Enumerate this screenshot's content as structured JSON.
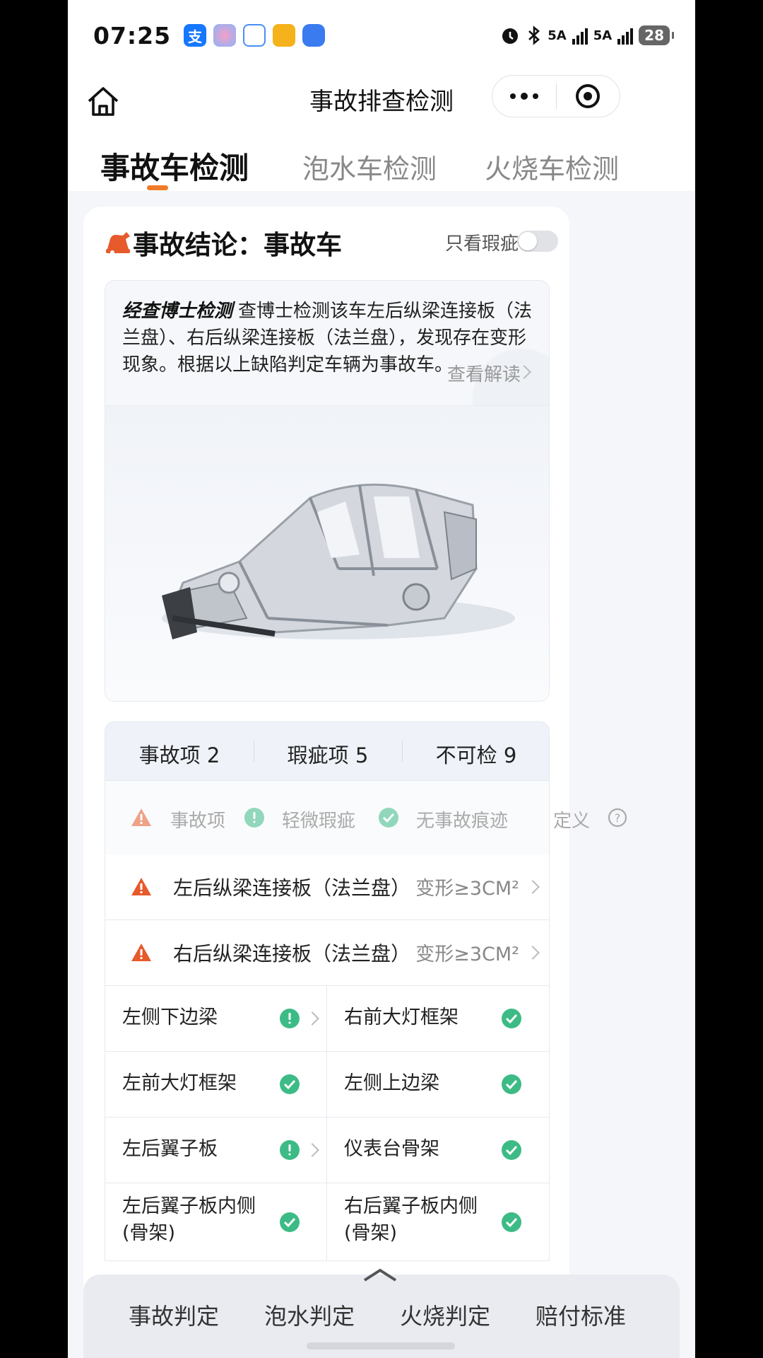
{
  "status_bar": {
    "time": "07:25",
    "network1": "5A",
    "network2": "5A",
    "battery": "28"
  },
  "nav": {
    "title": "事故排查检测"
  },
  "tabs": [
    {
      "label": "事故车检测",
      "active": true
    },
    {
      "label": "泡水车检测",
      "active": false
    },
    {
      "label": "火烧车检测",
      "active": false
    }
  ],
  "conclusion": {
    "title": "事故结论：事故车",
    "toggle_label": "只看瑕疵",
    "toggle_on": false
  },
  "diagnosis": {
    "brand": "经查博士检测",
    "text": "查博士检测该车左后纵梁连接板（法兰盘）、右后纵梁连接板（法兰盘），发现存在变形现象。根据以上缺陷判定车辆为事故车。",
    "read_more": "查看解读"
  },
  "stats": [
    {
      "label": "事故项 2"
    },
    {
      "label": "瑕疵项 5"
    },
    {
      "label": "不可检 9"
    }
  ],
  "legend": {
    "accident": "事故项",
    "minor": "轻微瑕疵",
    "none": "无事故痕迹",
    "definition": "定义"
  },
  "accident_items": [
    {
      "name": "左后纵梁连接板（法兰盘）",
      "value": "变形≥3CM²"
    },
    {
      "name": "右后纵梁连接板（法兰盘）",
      "value": "变形≥3CM²"
    }
  ],
  "grid_items": [
    {
      "name": "左侧下边梁",
      "status": "minor"
    },
    {
      "name": "右前大灯框架",
      "status": "ok"
    },
    {
      "name": "左前大灯框架",
      "status": "ok"
    },
    {
      "name": "左侧上边梁",
      "status": "ok"
    },
    {
      "name": "左后翼子板",
      "status": "minor"
    },
    {
      "name": "仪表台骨架",
      "status": "ok"
    },
    {
      "name": "左后翼子板内侧(骨架)",
      "status": "ok"
    },
    {
      "name": "右后翼子板内侧(骨架)",
      "status": "ok"
    }
  ],
  "bottom_bar": {
    "items": [
      "事故判定",
      "泡水判定",
      "火烧判定",
      "赔付标准"
    ]
  },
  "colors": {
    "accent": "#f07a2a",
    "warning": "#e65a2b",
    "ok": "#3dbb86"
  }
}
